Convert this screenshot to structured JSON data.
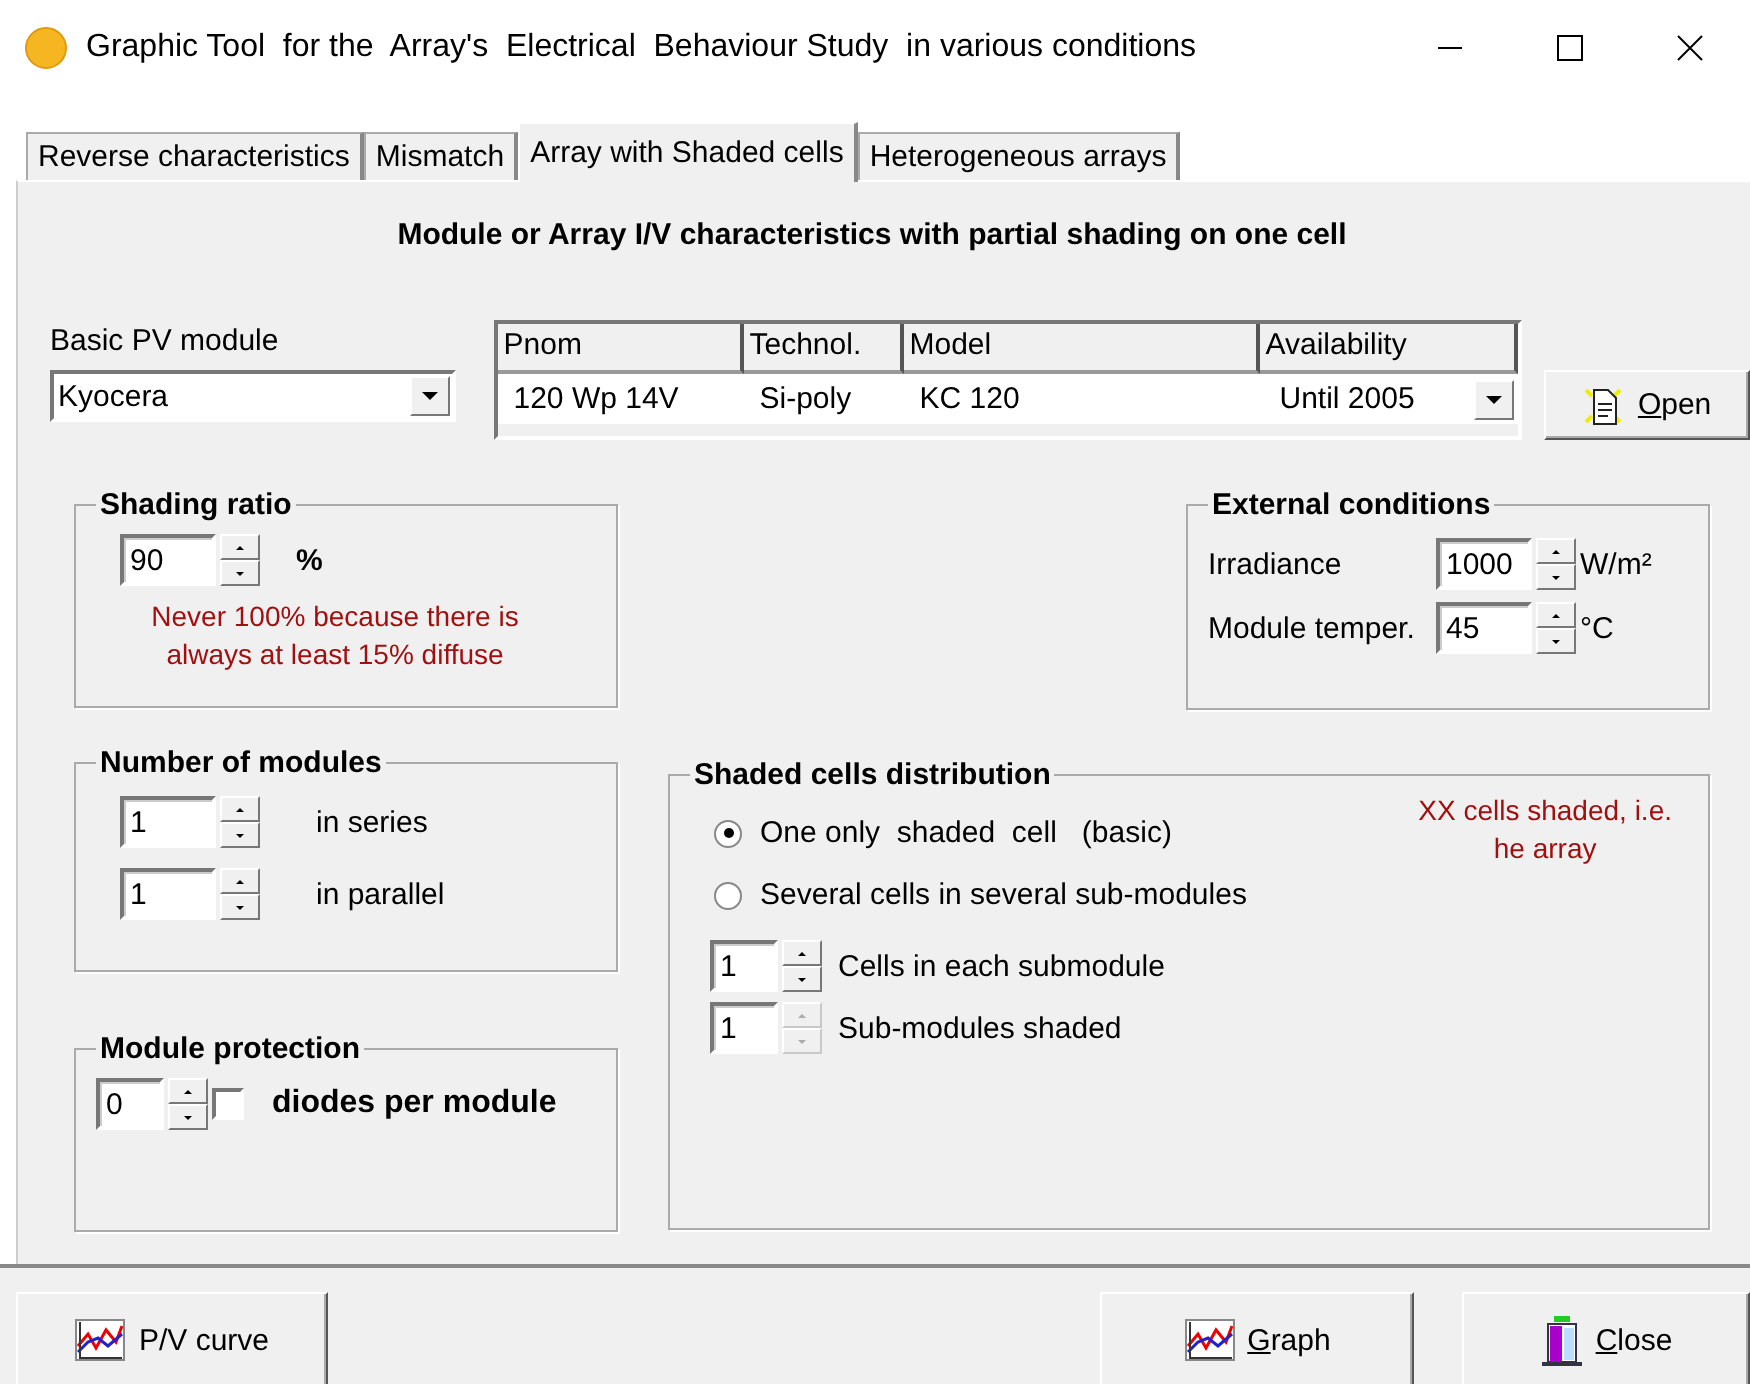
{
  "window": {
    "title": "Graphic Tool  for the  Array's  Electrical  Behaviour Study  in various conditions"
  },
  "tabs": [
    {
      "label": "Reverse characteristics",
      "selected": false
    },
    {
      "label": "Mismatch",
      "selected": false
    },
    {
      "label": "Array with Shaded cells",
      "selected": true
    },
    {
      "label": "Heterogeneous arrays",
      "selected": false
    }
  ],
  "heading": "Module or Array I/V characteristics with partial shading on one cell",
  "module": {
    "label": "Basic PV module",
    "value": "Kyocera"
  },
  "module_table": {
    "columns": [
      "Pnom",
      "Technol.",
      "Model",
      "Availability"
    ],
    "row": [
      "120 Wp 14V",
      "Si-poly",
      "KC 120",
      "Until 2005"
    ]
  },
  "open_button": {
    "label": "Open",
    "mnemonic": true
  },
  "shading_ratio": {
    "title": "Shading ratio",
    "value": "90",
    "unit": "%",
    "note": "Never 100% because there is always at least 15% diffuse"
  },
  "external_conditions": {
    "title": "External conditions",
    "fields": [
      {
        "label": "Irradiance",
        "value": "1000",
        "unit": "W/m²"
      },
      {
        "label": "Module temper.",
        "value": "45",
        "unit": "°C"
      }
    ]
  },
  "number_of_modules": {
    "title": "Number of modules",
    "fields": [
      {
        "value": "1",
        "label": "in series"
      },
      {
        "value": "1",
        "label": "in parallel"
      }
    ]
  },
  "module_protection": {
    "title": "Module protection",
    "value": "0",
    "checked": false,
    "label": "diodes per module"
  },
  "shaded_cells_distribution": {
    "title": "Shaded cells distribution",
    "options": [
      {
        "label": "One only  shaded  cell   (basic)",
        "selected": true
      },
      {
        "label": "Several cells in several sub-modules",
        "selected": false
      }
    ],
    "note": [
      "XX cells shaded, i.e.",
      "he array"
    ],
    "fields": [
      {
        "value": "1",
        "label": "Cells in each submodule",
        "disabled": false
      },
      {
        "value": "1",
        "label": "Sub-modules shaded",
        "disabled": true
      }
    ]
  },
  "buttons": [
    {
      "label": "P/V curve",
      "kind": "chart",
      "mnemonic": false
    },
    {
      "label": "Graph",
      "kind": "chart",
      "mnemonic": true
    },
    {
      "label": "Close",
      "kind": "door",
      "mnemonic": true
    }
  ]
}
